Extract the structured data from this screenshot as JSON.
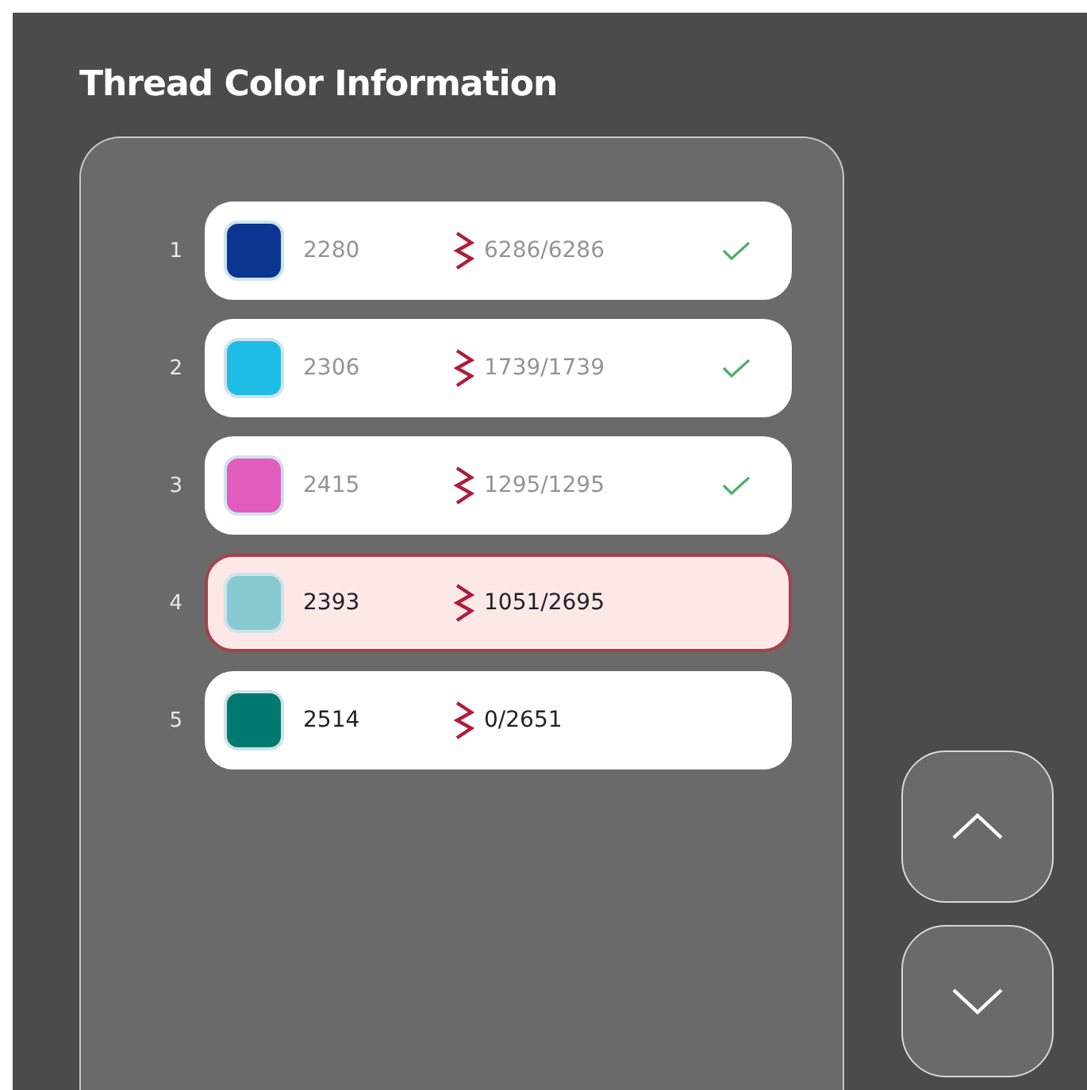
{
  "title": "Thread Color Information",
  "threads": [
    {
      "index": "1",
      "color": "#0a3590",
      "code": "2280",
      "count": "6286/6286",
      "completed": true,
      "selected": false
    },
    {
      "index": "2",
      "color": "#1ebde6",
      "code": "2306",
      "count": "1739/1739",
      "completed": true,
      "selected": false
    },
    {
      "index": "3",
      "color": "#e25cbf",
      "code": "2415",
      "count": "1295/1295",
      "completed": true,
      "selected": false
    },
    {
      "index": "4",
      "color": "#86c9d1",
      "code": "2393",
      "count": "1051/2695",
      "completed": false,
      "selected": true
    },
    {
      "index": "5",
      "color": "#007a70",
      "code": "2514",
      "count": "0/2651",
      "completed": false,
      "selected": false
    }
  ]
}
